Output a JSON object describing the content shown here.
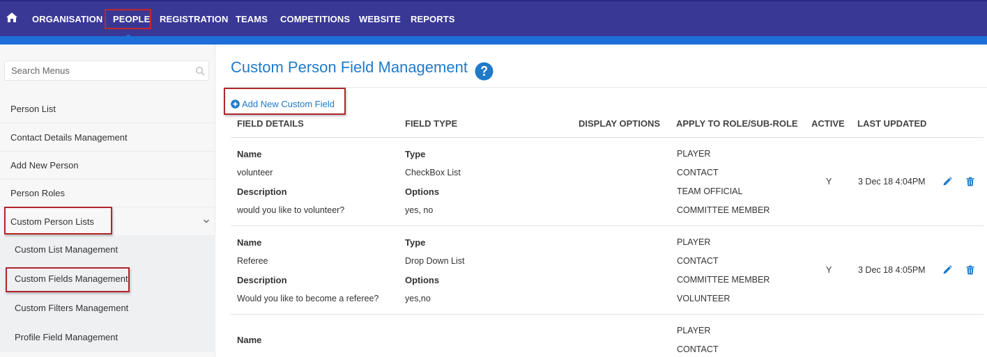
{
  "nav": {
    "items": [
      "ORGANISATION",
      "PEOPLE",
      "REGISTRATION",
      "TEAMS",
      "COMPETITIONS",
      "WEBSITE",
      "REPORTS"
    ],
    "active": "PEOPLE",
    "color": "#3a3895",
    "accent": "#1d6fd8"
  },
  "sidebar": {
    "search_placeholder": "Search Menus",
    "items": [
      "Person List",
      "Contact Details Management",
      "Add New Person",
      "Person Roles",
      "Custom Person Lists"
    ],
    "subitems": [
      "Custom List Management",
      "Custom Fields Management",
      "Custom Filters Management",
      "Profile Field Management"
    ]
  },
  "main": {
    "title": "Custom Person Field Management",
    "add_label": "Add New Custom Field",
    "columns": [
      "FIELD DETAILS",
      "FIELD TYPE",
      "DISPLAY OPTIONS",
      "APPLY TO ROLE/SUB-ROLE",
      "ACTIVE",
      "LAST UPDATED"
    ],
    "rows": [
      {
        "name_label": "Name",
        "name": "volunteer",
        "desc_label": "Description",
        "desc": "would you like to volunteer?",
        "type_label": "Type",
        "type": "CheckBox List",
        "options_label": "Options",
        "options": "yes, no",
        "roles": [
          "PLAYER",
          "CONTACT",
          "TEAM OFFICIAL",
          "COMMITTEE MEMBER"
        ],
        "active": "Y",
        "updated": "3 Dec 18 4:04PM"
      },
      {
        "name_label": "Name",
        "name": "Referee",
        "desc_label": "Description",
        "desc": "Would you like to become a referee?",
        "type_label": "Type",
        "type": "Drop Down List",
        "options_label": "Options",
        "options": "yes,no",
        "roles": [
          "PLAYER",
          "CONTACT",
          "COMMITTEE MEMBER",
          "VOLUNTEER"
        ],
        "active": "Y",
        "updated": "3 Dec 18 4:05PM"
      },
      {
        "name_label": "Name",
        "roles": [
          "PLAYER",
          "CONTACT"
        ]
      }
    ]
  }
}
